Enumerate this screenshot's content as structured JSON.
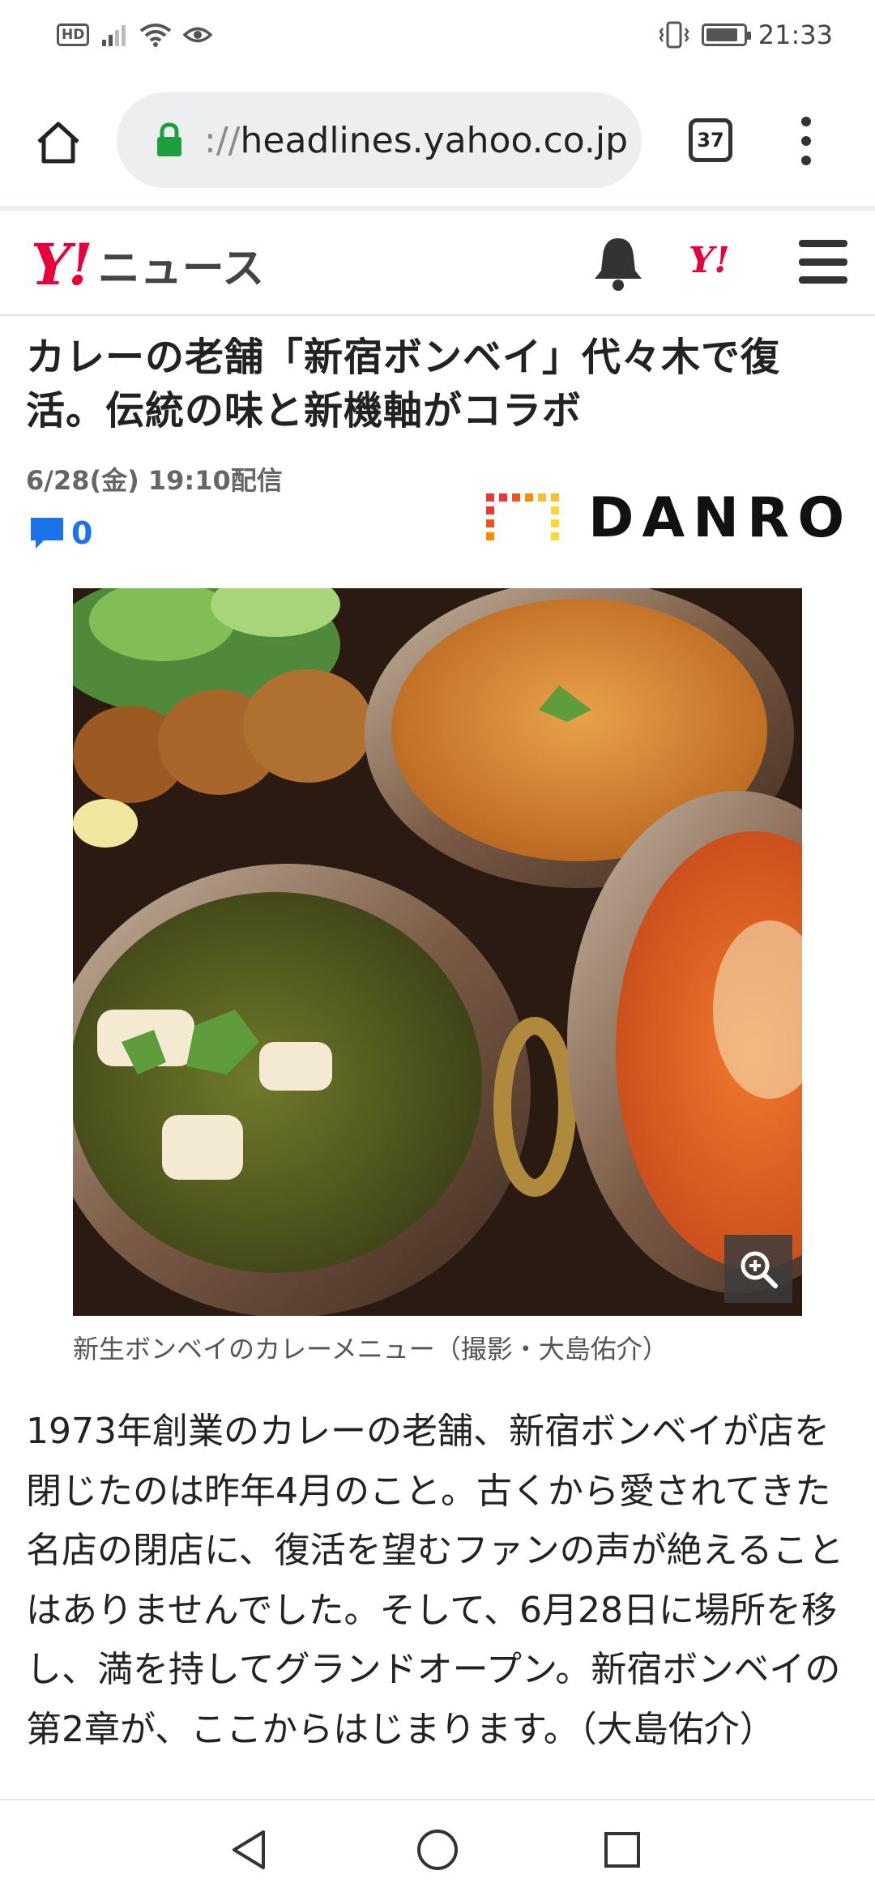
{
  "status_bar": {
    "hd_badge": "HD",
    "time": "21:33"
  },
  "browser": {
    "url_prefix": "://",
    "url_host": "headlines.yahoo.co.jp",
    "tab_count": "37"
  },
  "site": {
    "logo_mark": "Y!",
    "logo_text": "ニュース",
    "small_logo": "Y!"
  },
  "article": {
    "headline": "カレーの老舗「新宿ボンベイ」代々木で復活。伝統の味と新機軸がコラボ",
    "date": "6/28(金) 19:10配信",
    "comment_count": "0",
    "publisher": "DANRO",
    "photo_caption": "新生ボンベイのカレーメニュー（撮影・大島佑介）",
    "body": "1973年創業のカレーの老舗、新宿ボンベイが店を閉じたのは昨年4月のこと。古くから愛されてきた名店の閉店に、復活を望むファンの声が絶えることはありませんでした。そして、6月28日に場所を移し、満を持してグランドオープン。新宿ボンベイの第2章が、ここからはじまります。（大島佑介）"
  },
  "colors": {
    "yahoo_red": "#e6003c",
    "comment_blue": "#1a73e8",
    "lock_green": "#1e9e3e"
  }
}
